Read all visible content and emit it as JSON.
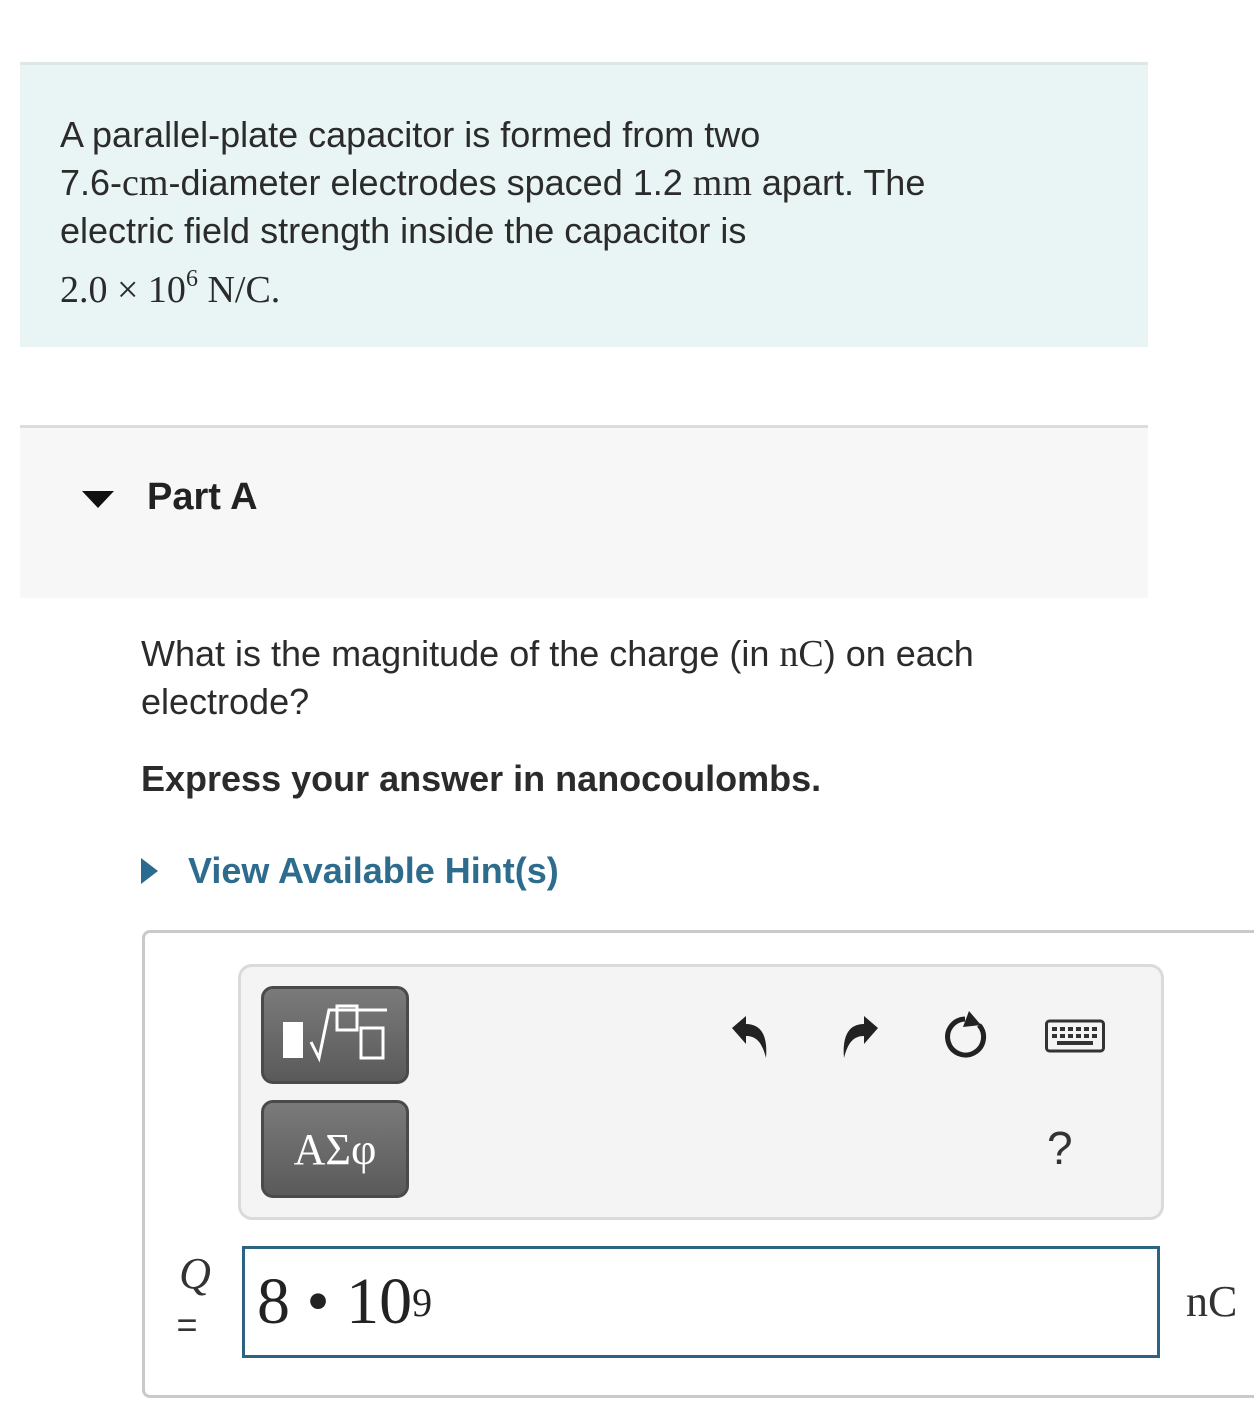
{
  "problem": {
    "line1": "A parallel-plate capacitor is formed from two",
    "line2_num": "7.6-",
    "line2_unit": "cm",
    "line2_rest": "-diameter electrodes spaced 1.2 ",
    "line2_unit2": "mm",
    "line2_end": " apart. The",
    "line3": "electric field strength inside the capacitor is",
    "line4_mant": "2.0 × 10",
    "line4_exp": "6",
    "line4_unit": " N/C."
  },
  "part": {
    "title": "Part A"
  },
  "question": {
    "text_before": "What is the magnitude of the charge (in ",
    "unit": "nC",
    "text_after": ") on each electrode?",
    "instruction": "Express your answer in nanocoulombs."
  },
  "hint": {
    "label": "View Available Hint(s)"
  },
  "toolbar": {
    "symbols_label": "ΑΣφ",
    "help_label": "?"
  },
  "answer": {
    "variable": "Q",
    "equals": "=",
    "value_base": "8 • 10",
    "value_exp": "9",
    "unit": "nC"
  },
  "colors": {
    "problem_bg": "#e9f5f4",
    "link": "#2e6c8e",
    "input_border": "#2c6380"
  },
  "icons": [
    "triangle-down-icon",
    "triangle-right-icon",
    "fraction-root-icon",
    "undo-icon",
    "redo-icon",
    "reset-icon",
    "keyboard-icon"
  ]
}
